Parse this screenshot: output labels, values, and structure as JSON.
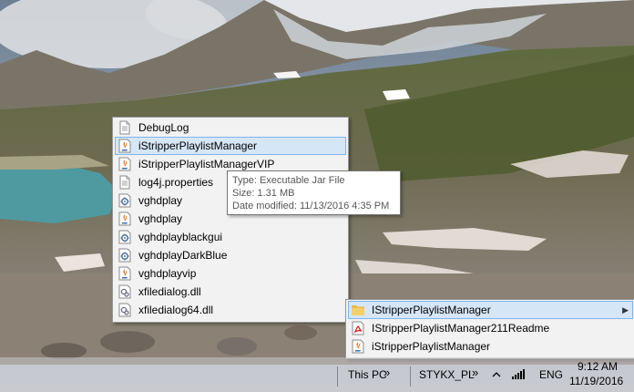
{
  "menu_main": {
    "selected_index": 1,
    "items": [
      {
        "label": "DebugLog",
        "icon": "text-file-icon"
      },
      {
        "label": "iStripperPlaylistManager",
        "icon": "java-jar-icon"
      },
      {
        "label": "iStripperPlaylistManagerVIP",
        "icon": "java-jar-icon"
      },
      {
        "label": "log4j.properties",
        "icon": "text-file-icon"
      },
      {
        "label": "vghdplay",
        "icon": "settings-file-icon"
      },
      {
        "label": "vghdplay",
        "icon": "java-jar-icon"
      },
      {
        "label": "vghdplayblackgui",
        "icon": "settings-file-icon"
      },
      {
        "label": "vghdplayDarkBlue",
        "icon": "settings-file-icon"
      },
      {
        "label": "vghdplayvip",
        "icon": "java-jar-icon"
      },
      {
        "label": "xfiledialog.dll",
        "icon": "dll-file-icon"
      },
      {
        "label": "xfiledialog64.dll",
        "icon": "dll-file-icon"
      }
    ]
  },
  "tooltip": {
    "line1": "Type: Executable Jar File",
    "line2": "Size: 1.31 MB",
    "line3": "Date modified: 11/13/2016 4:35 PM"
  },
  "menu_toolbar": {
    "items": [
      {
        "label": "IStripperPlaylistManager",
        "icon": "folder-icon",
        "has_submenu": true
      },
      {
        "label": "IStripperPlaylistManager211Readme",
        "icon": "pdf-file-icon"
      },
      {
        "label": "iStripperPlaylistManager",
        "icon": "java-jar-icon"
      }
    ]
  },
  "taskbar": {
    "this_pc": "This PC",
    "toolbar_name": "STYKX_PL",
    "chevron": "»",
    "language": "ENG",
    "time": "9:12 AM",
    "date": "11/19/2016"
  },
  "colors": {
    "selection_bg": "#d5e6f7",
    "selection_border": "#7eb4ea",
    "menu_bg": "#f2f2f2"
  }
}
